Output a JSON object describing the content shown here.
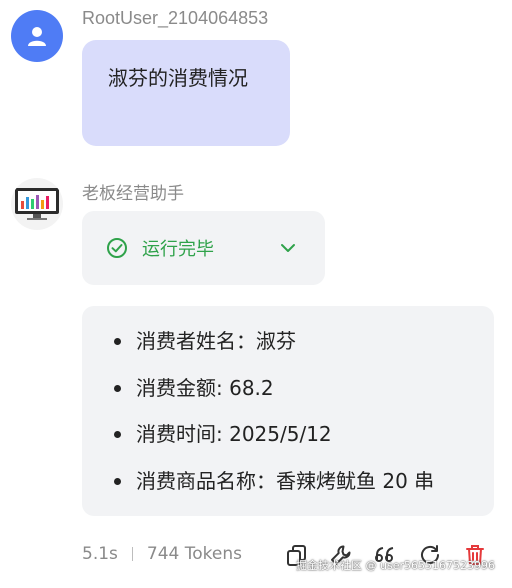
{
  "user": {
    "name": "RootUser_2104064853",
    "message": "淑芬的消费情况"
  },
  "bot": {
    "name": "老板经营助手",
    "status": "运行完毕",
    "items": [
      "消费者姓名：淑芬",
      "消费金额: 68.2",
      "消费时间: 2025/5/12",
      "消费商品名称：香辣烤鱿鱼 20 串"
    ]
  },
  "footer": {
    "time": "5.1s",
    "tokens": "744 Tokens"
  },
  "watermark": "掘金技术社区 @ user5655167523996",
  "colors": {
    "user_bubble": "#d9dcfb",
    "user_avatar": "#4f7cf5",
    "status_green": "#2fa24a",
    "delete_red": "#e5393b"
  }
}
